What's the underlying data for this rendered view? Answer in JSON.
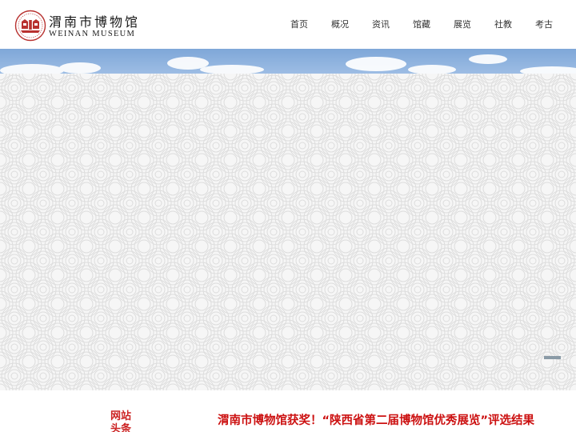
{
  "brand": {
    "name_cn": "渭南市博物馆",
    "name_en": "WEINAN MUSEUM"
  },
  "nav": {
    "items": [
      "首页",
      "概况",
      "资讯",
      "馆藏",
      "展览",
      "社教",
      "考古"
    ]
  },
  "news": {
    "tag": "网站头条",
    "headline": "渭南市博物馆获奖！“陕西省第二届博物馆优秀展览”评选结果"
  },
  "colors": {
    "brand_red": "#b8312f",
    "headline_red": "#cc1111",
    "nav_text": "#333333"
  }
}
